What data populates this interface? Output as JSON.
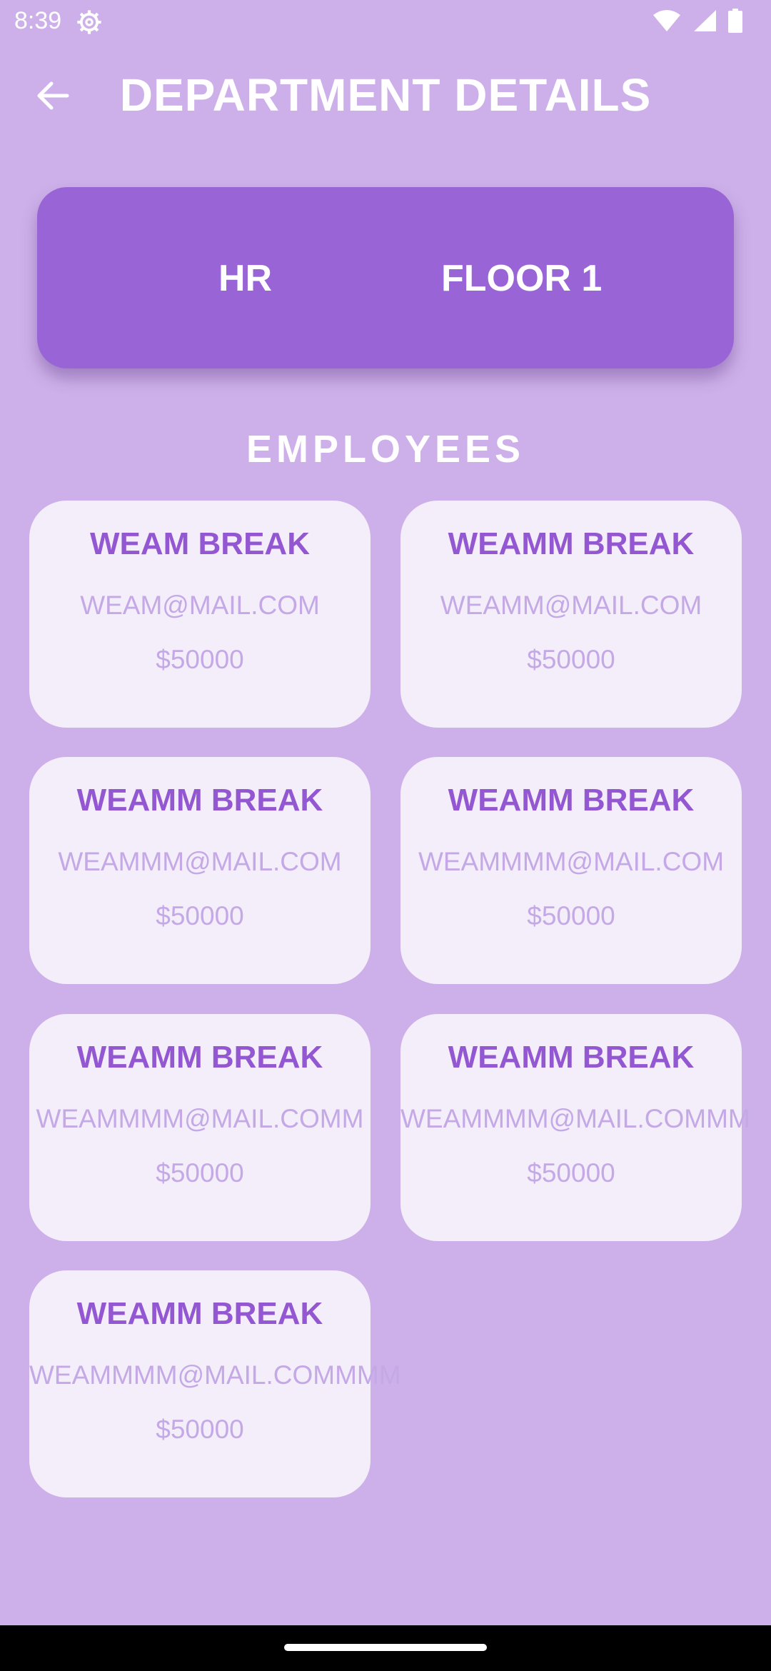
{
  "status_bar": {
    "time": "8:39",
    "icons": [
      "settings-gear-icon",
      "wifi-icon",
      "cell-signal-icon",
      "battery-icon"
    ]
  },
  "app_bar": {
    "back_icon": "arrow-left-icon",
    "title": "DEPARTMENT DETAILS"
  },
  "department": {
    "name": "HR",
    "floor": "FLOOR 1"
  },
  "employees_section": {
    "title": "EMPLOYEES",
    "items": [
      {
        "name": "WEAM BREAK",
        "email": "WEAM@MAIL.COM",
        "salary": "$50000"
      },
      {
        "name": "WEAMM BREAK",
        "email": "WEAMM@MAIL.COM",
        "salary": "$50000"
      },
      {
        "name": "WEAMM BREAK",
        "email": "WEAMMM@MAIL.COM",
        "salary": "$50000"
      },
      {
        "name": "WEAMM BREAK",
        "email": "WEAMMMM@MAIL.COM",
        "salary": "$50000"
      },
      {
        "name": "WEAMM BREAK",
        "email": "WEAMMMM@MAIL.COMM",
        "salary": "$50000"
      },
      {
        "name": "WEAMM BREAK",
        "email": "WEAMMMM@MAIL.COMMM",
        "salary": "$50000"
      },
      {
        "name": "WEAMM BREAK",
        "email": "WEAMMMM@MAIL.COMMMM",
        "salary": "$50000"
      }
    ]
  },
  "colors": {
    "background": "#cdb0e9",
    "accent": "#9965d6",
    "card": "#f3eefa",
    "name_text": "#9457d2",
    "secondary_text": "#c4a9e6"
  }
}
